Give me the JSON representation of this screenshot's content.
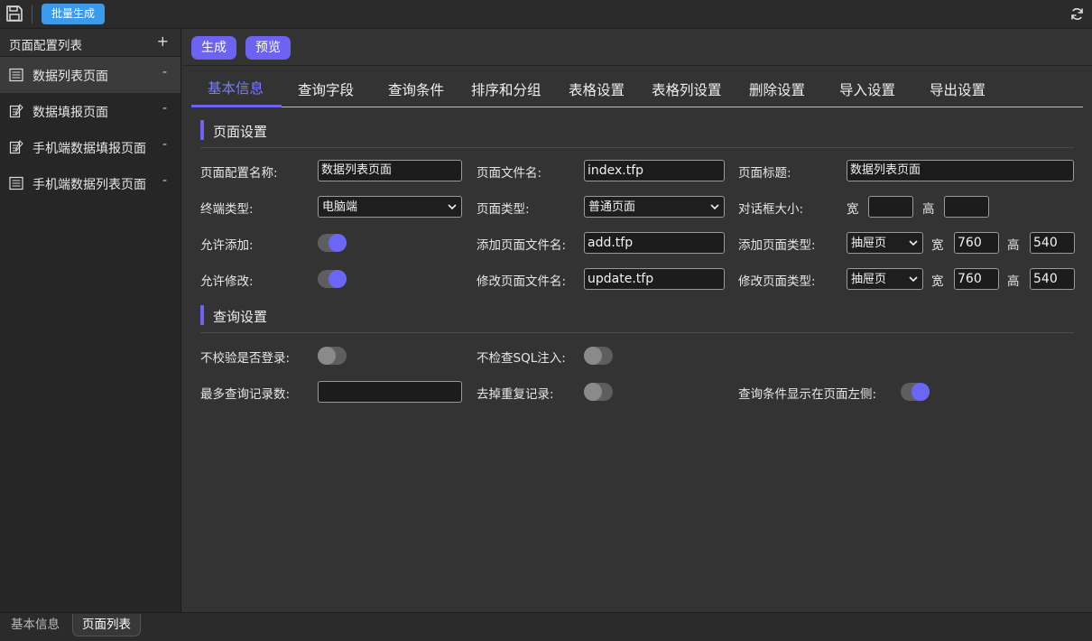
{
  "toolbar": {
    "batch_label": "批量生成"
  },
  "sidebar": {
    "title": "页面配置列表",
    "add_symbol": "+",
    "items": [
      {
        "label": "数据列表页面",
        "remove": "-"
      },
      {
        "label": "数据填报页面",
        "remove": "-"
      },
      {
        "label": "手机端数据填报页面",
        "remove": "-"
      },
      {
        "label": "手机端数据列表页面",
        "remove": "-"
      }
    ]
  },
  "actions": {
    "generate": "生成",
    "preview": "预览"
  },
  "tabs": [
    "基本信息",
    "查询字段",
    "查询条件",
    "排序和分组",
    "表格设置",
    "表格列设置",
    "删除设置",
    "导入设置",
    "导出设置"
  ],
  "page_settings": {
    "title": "页面设置",
    "config_name_label": "页面配置名称:",
    "config_name_value": "数据列表页面",
    "file_name_label": "页面文件名:",
    "file_name_value": "index.tfp",
    "page_title_label": "页面标题:",
    "page_title_value": "数据列表页面",
    "terminal_label": "终端类型:",
    "terminal_value": "电脑端",
    "page_type_label": "页面类型:",
    "page_type_value": "普通页面",
    "dialog_size_label": "对话框大小:",
    "width_label": "宽",
    "height_label": "高",
    "dialog_width": "",
    "dialog_height": "",
    "allow_add_label": "允许添加:",
    "allow_add": true,
    "add_file_label": "添加页面文件名:",
    "add_file_value": "add.tfp",
    "add_type_label": "添加页面类型:",
    "add_type_value": "抽屉页",
    "add_width": "760",
    "add_height": "540",
    "allow_edit_label": "允许修改:",
    "allow_edit": true,
    "edit_file_label": "修改页面文件名:",
    "edit_file_value": "update.tfp",
    "edit_type_label": "修改页面类型:",
    "edit_type_value": "抽屉页",
    "edit_width": "760",
    "edit_height": "540"
  },
  "query_settings": {
    "title": "查询设置",
    "no_login_check_label": "不校验是否登录:",
    "no_login_check": false,
    "no_sql_check_label": "不检查SQL注入:",
    "no_sql_check": false,
    "max_records_label": "最多查询记录数:",
    "max_records_value": "",
    "dedupe_label": "去掉重复记录:",
    "dedupe": false,
    "left_conditions_label": "查询条件显示在页面左侧:",
    "left_conditions": true
  },
  "bottom_tabs": [
    "基本信息",
    "页面列表"
  ],
  "colors": {
    "accent": "#6c63f0",
    "batch_button": "#3d9ae8"
  }
}
